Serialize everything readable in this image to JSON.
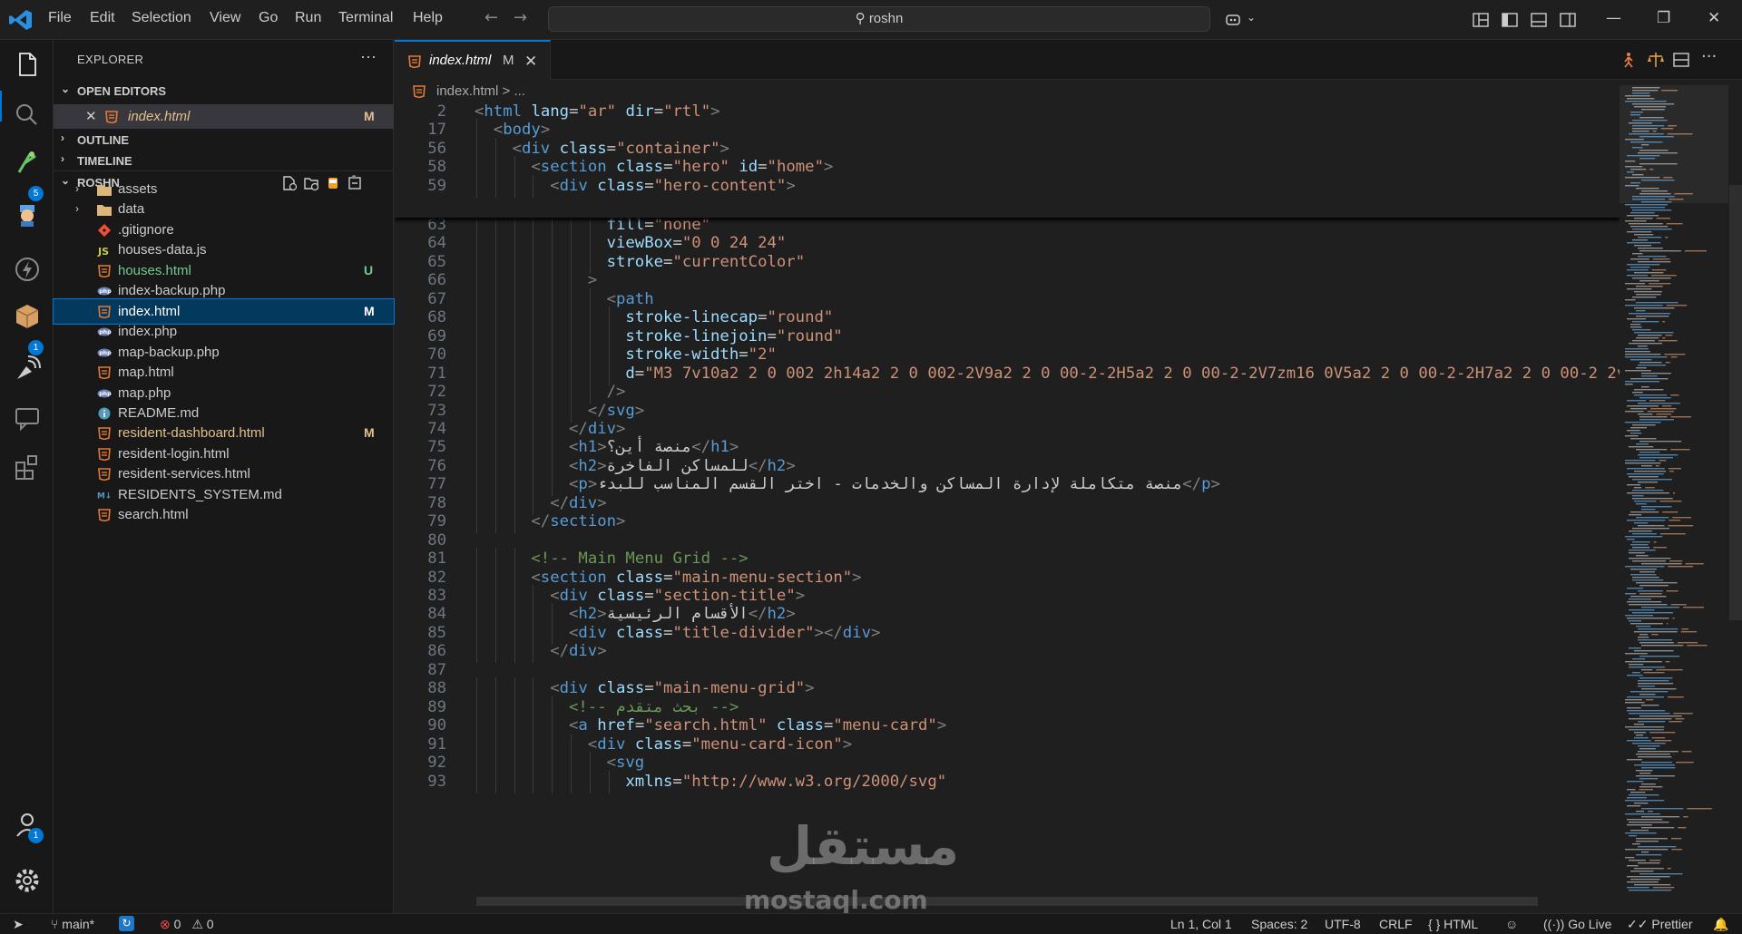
{
  "titlebar": {
    "menus": [
      "File",
      "Edit",
      "Selection",
      "View",
      "Go",
      "Run",
      "Terminal",
      "Help"
    ],
    "search": "roshn"
  },
  "activity": {
    "icons": [
      "explorer-icon",
      "search-icon",
      "source-control-icon",
      "extension-spy-icon",
      "lightning-icon",
      "package-icon",
      "remote-icon",
      "chat-icon",
      "extensions-icon",
      "accounts-icon",
      "settings-icon"
    ],
    "badges": {
      "source_control": "5",
      "package": "1",
      "accounts": "1"
    }
  },
  "sidebar": {
    "title": "EXPLORER",
    "more": "···",
    "open_editors_label": "OPEN EDITORS",
    "open_editor": {
      "name": "index.html",
      "status": "M"
    },
    "outline_label": "OUTLINE",
    "timeline_label": "TIMELINE",
    "project_label": "ROSHN",
    "items": [
      {
        "name": "assets",
        "type": "folder",
        "status": ""
      },
      {
        "name": "data",
        "type": "folder",
        "status": ""
      },
      {
        "name": ".gitignore",
        "type": "git",
        "status": ""
      },
      {
        "name": "houses-data.js",
        "type": "js",
        "status": ""
      },
      {
        "name": "houses.html",
        "type": "html",
        "status": "U"
      },
      {
        "name": "index-backup.php",
        "type": "php",
        "status": ""
      },
      {
        "name": "index.html",
        "type": "html",
        "status": "M"
      },
      {
        "name": "index.php",
        "type": "php",
        "status": ""
      },
      {
        "name": "map-backup.php",
        "type": "php",
        "status": ""
      },
      {
        "name": "map.html",
        "type": "html",
        "status": ""
      },
      {
        "name": "map.php",
        "type": "php",
        "status": ""
      },
      {
        "name": "README.md",
        "type": "info",
        "status": ""
      },
      {
        "name": "resident-dashboard.html",
        "type": "html",
        "status": "M"
      },
      {
        "name": "resident-login.html",
        "type": "html",
        "status": ""
      },
      {
        "name": "resident-services.html",
        "type": "html",
        "status": ""
      },
      {
        "name": "RESIDENTS_SYSTEM.md",
        "type": "md",
        "status": ""
      },
      {
        "name": "search.html",
        "type": "html",
        "status": ""
      }
    ]
  },
  "editor": {
    "tab": {
      "name": "index.html",
      "status": "M",
      "close": "✕"
    },
    "breadcrumb": "index.html  >  ...",
    "sticky_lines": [
      {
        "n": "2",
        "indent": 0,
        "text": "<html lang=\"ar\" dir=\"rtl\">"
      },
      {
        "n": "17",
        "indent": 1,
        "text": "<body>"
      },
      {
        "n": "56",
        "indent": 2,
        "text": "<div class=\"container\">"
      },
      {
        "n": "58",
        "indent": 3,
        "text": "<section class=\"hero\" id=\"home\">"
      },
      {
        "n": "59",
        "indent": 4,
        "text": "<div class=\"hero-content\">"
      }
    ],
    "lines": [
      {
        "n": "63",
        "indent": 7,
        "text": "fill=\"none\""
      },
      {
        "n": "64",
        "indent": 7,
        "text": "viewBox=\"0 0 24 24\""
      },
      {
        "n": "65",
        "indent": 7,
        "text": "stroke=\"currentColor\""
      },
      {
        "n": "66",
        "indent": 6,
        "text": ">"
      },
      {
        "n": "67",
        "indent": 7,
        "text": "<path"
      },
      {
        "n": "68",
        "indent": 8,
        "text": "stroke-linecap=\"round\""
      },
      {
        "n": "69",
        "indent": 8,
        "text": "stroke-linejoin=\"round\""
      },
      {
        "n": "70",
        "indent": 8,
        "text": "stroke-width=\"2\""
      },
      {
        "n": "71",
        "indent": 8,
        "text": "d=\"M3 7v10a2 2 0 002 2h14a2 2 0 002-2V9a2 2 0 00-2-2H5a2 2 0 00-2-2V7zm16 0V5a2 2 0 00-2-2H7a2 2 0 00-2 2v"
      },
      {
        "n": "72",
        "indent": 7,
        "text": "/>"
      },
      {
        "n": "73",
        "indent": 6,
        "text": "</svg>"
      },
      {
        "n": "74",
        "indent": 5,
        "text": "</div>"
      },
      {
        "n": "75",
        "indent": 5,
        "text": "<h1>منصة أين؟</h1>"
      },
      {
        "n": "76",
        "indent": 5,
        "text": "<h2>للمساكن الفاخرة</h2>"
      },
      {
        "n": "77",
        "indent": 5,
        "text": "<p>منصة متكاملة لإدارة المساكن والخدمات - اختر القسم المناسب للبدء</p>"
      },
      {
        "n": "78",
        "indent": 4,
        "text": "</div>"
      },
      {
        "n": "79",
        "indent": 3,
        "text": "</section>"
      },
      {
        "n": "80",
        "indent": 0,
        "text": ""
      },
      {
        "n": "81",
        "indent": 3,
        "text": "<!-- Main Menu Grid -->"
      },
      {
        "n": "82",
        "indent": 3,
        "text": "<section class=\"main-menu-section\">"
      },
      {
        "n": "83",
        "indent": 4,
        "text": "<div class=\"section-title\">"
      },
      {
        "n": "84",
        "indent": 5,
        "text": "<h2>الأقسام الرئيسية</h2>"
      },
      {
        "n": "85",
        "indent": 5,
        "text": "<div class=\"title-divider\"></div>"
      },
      {
        "n": "86",
        "indent": 4,
        "text": "</div>"
      },
      {
        "n": "87",
        "indent": 0,
        "text": ""
      },
      {
        "n": "88",
        "indent": 4,
        "text": "<div class=\"main-menu-grid\">"
      },
      {
        "n": "89",
        "indent": 5,
        "text": "<!-- بحث متقدم -->"
      },
      {
        "n": "90",
        "indent": 5,
        "text": "<a href=\"search.html\" class=\"menu-card\">"
      },
      {
        "n": "91",
        "indent": 6,
        "text": "<div class=\"menu-card-icon\">"
      },
      {
        "n": "92",
        "indent": 7,
        "text": "<svg"
      },
      {
        "n": "93",
        "indent": 8,
        "text": "xmlns=\"http://www.w3.org/2000/svg\""
      }
    ]
  },
  "watermark": {
    "ar": "مستقل",
    "url": "mostaql.com"
  },
  "status": {
    "branch": "main*",
    "errors": "0",
    "warnings": "0",
    "position": "Ln 1, Col 1",
    "spaces": "Spaces: 2",
    "encoding": "UTF-8",
    "eol": "CRLF",
    "language": "HTML",
    "language_braces": "{ }",
    "golive": "Go Live",
    "prettier": "Prettier"
  },
  "colors": {
    "accent": "#0078d4",
    "html": "#e37933",
    "js": "#cbcb41",
    "php": "#6a7fb5",
    "folder": "#dcb67a",
    "modified": "#e2c08d",
    "untracked": "#73c991"
  }
}
